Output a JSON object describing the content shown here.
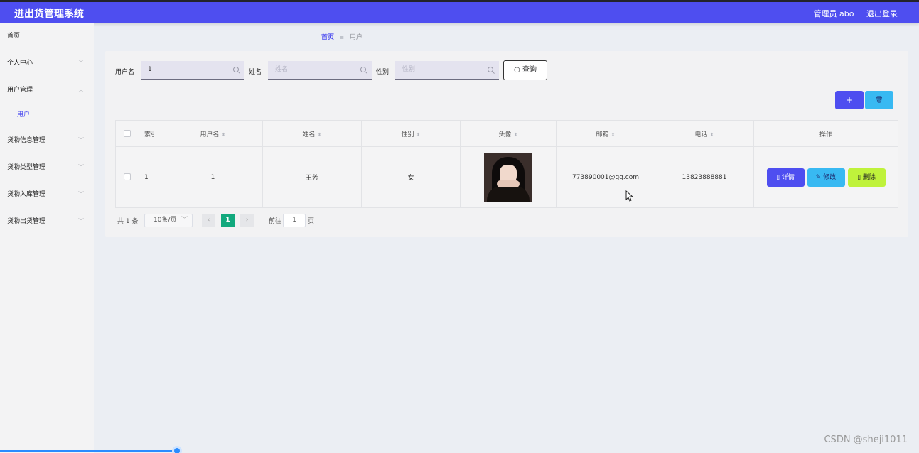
{
  "header": {
    "title": "进出货管理系统",
    "user_label": "管理员 abo",
    "logout_label": "退出登录"
  },
  "sidebar": {
    "items": [
      {
        "label": "首页"
      },
      {
        "label": "个人中心"
      },
      {
        "label": "用户管理"
      },
      {
        "label": "用户"
      },
      {
        "label": "货物信息管理"
      },
      {
        "label": "货物类型管理"
      },
      {
        "label": "货物入库管理"
      },
      {
        "label": "货物出货管理"
      }
    ]
  },
  "breadcrumb": {
    "home": "首页",
    "current": "用户"
  },
  "search": {
    "username_label": "用户名",
    "username_value": "1",
    "name_label": "姓名",
    "name_placeholder": "姓名",
    "gender_label": "性别",
    "gender_placeholder": "性别",
    "query_label": "查询"
  },
  "toolbar": {
    "add_label": "+",
    "delete_label": "🗑"
  },
  "table": {
    "columns": [
      "索引",
      "用户名",
      "姓名",
      "性别",
      "头像",
      "邮箱",
      "电话",
      "操作"
    ],
    "rows": [
      {
        "index": "1",
        "username": "1",
        "name": "王芳",
        "gender": "女",
        "email": "773890001@qq.com",
        "phone": "13823888881",
        "detail_label": "详情",
        "edit_label": "修改",
        "delete_label": "删除"
      }
    ]
  },
  "pagination": {
    "total_text": "共 1 条",
    "page_size": "10条/页",
    "current_page": "1",
    "jump_prefix": "前往",
    "jump_value": "1",
    "jump_suffix": "页"
  },
  "watermark": "CSDN @sheji1011",
  "colors": {
    "primary": "#4e4ef0",
    "info": "#38b9f2",
    "danger": "#bff23b",
    "pager_active": "#12a97d"
  }
}
